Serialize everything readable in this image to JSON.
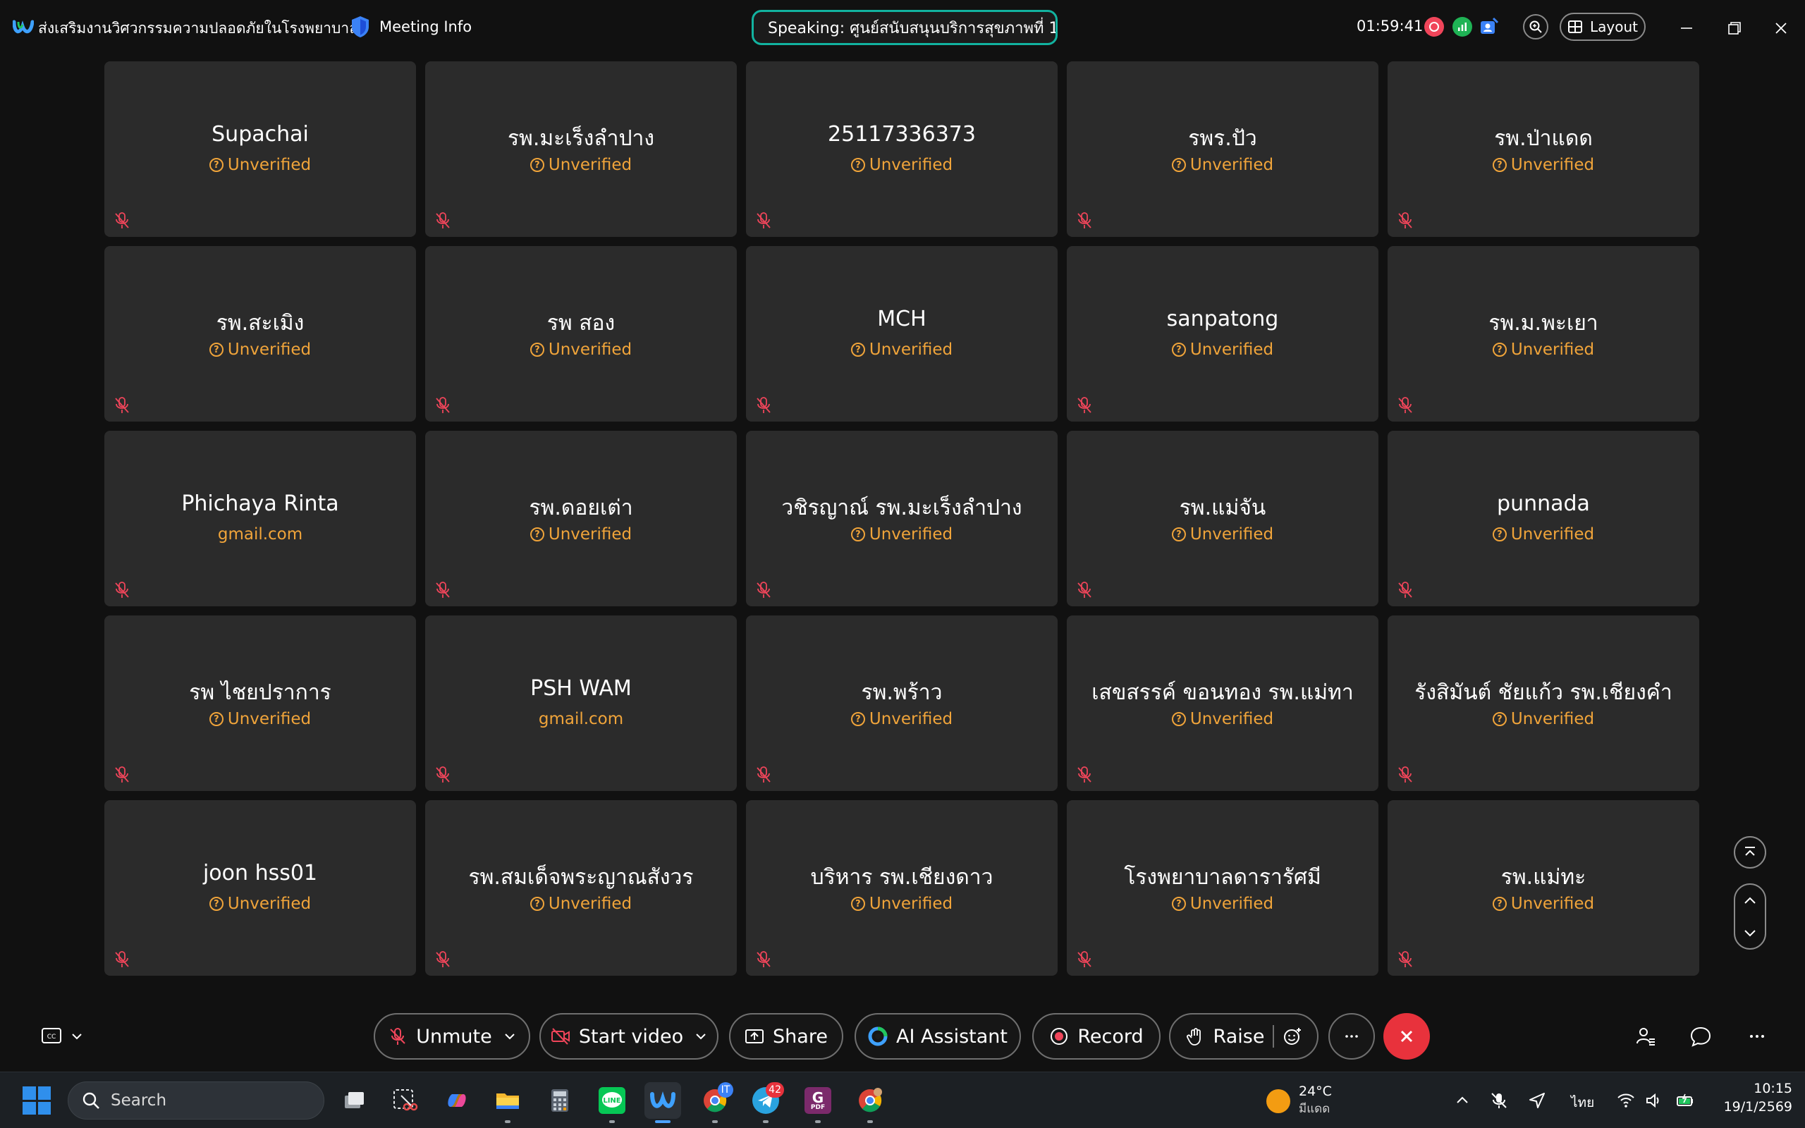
{
  "titlebar": {
    "meeting_title": "ส่งเสริมงานวิศวกรรมความปลอดภัยในโรงพยาบาล",
    "meeting_info_label": "Meeting Info",
    "speaking": "Speaking: ศูนย์สนับสนุนบริการสุขภาพที่ 1",
    "elapsed": "01:59:41",
    "layout_label": "Layout"
  },
  "participants": [
    {
      "name": "Supachai",
      "status": "Unverified",
      "verified_domain": false
    },
    {
      "name": "รพ.มะเร็งลำปาง",
      "status": "Unverified",
      "verified_domain": false
    },
    {
      "name": "25117336373",
      "status": "Unverified",
      "verified_domain": false
    },
    {
      "name": "รพร.ปัว",
      "status": "Unverified",
      "verified_domain": false
    },
    {
      "name": "รพ.ป่าแดด",
      "status": "Unverified",
      "verified_domain": false
    },
    {
      "name": "รพ.สะเมิง",
      "status": "Unverified",
      "verified_domain": false
    },
    {
      "name": "รพ สอง",
      "status": "Unverified",
      "verified_domain": false
    },
    {
      "name": "MCH",
      "status": "Unverified",
      "verified_domain": false
    },
    {
      "name": "sanpatong",
      "status": "Unverified",
      "verified_domain": false
    },
    {
      "name": "รพ.ม.พะเยา",
      "status": "Unverified",
      "verified_domain": false
    },
    {
      "name": "Phichaya Rinta",
      "status": "gmail.com",
      "verified_domain": true
    },
    {
      "name": "รพ.ดอยเต่า",
      "status": "Unverified",
      "verified_domain": false
    },
    {
      "name": "วชิรญาณ์ รพ.มะเร็งลำปาง",
      "status": "Unverified",
      "verified_domain": false
    },
    {
      "name": "รพ.แม่จัน",
      "status": "Unverified",
      "verified_domain": false
    },
    {
      "name": "punnada",
      "status": "Unverified",
      "verified_domain": false
    },
    {
      "name": "รพ ไชยปราการ",
      "status": "Unverified",
      "verified_domain": false
    },
    {
      "name": "PSH WAM",
      "status": "gmail.com",
      "verified_domain": true
    },
    {
      "name": "รพ.พร้าว",
      "status": "Unverified",
      "verified_domain": false
    },
    {
      "name": "เสขสรรค์ ขอนทอง รพ.แม่ทา",
      "status": "Unverified",
      "verified_domain": false
    },
    {
      "name": "รังสิมันต์ ชัยแก้ว รพ.เชียงคำ",
      "status": "Unverified",
      "verified_domain": false
    },
    {
      "name": "joon hss01",
      "status": "Unverified",
      "verified_domain": false
    },
    {
      "name": "รพ.สมเด็จพระญาณสังวร",
      "status": "Unverified",
      "verified_domain": false
    },
    {
      "name": "บริหาร รพ.เชียงดาว",
      "status": "Unverified",
      "verified_domain": false
    },
    {
      "name": "โรงพยาบาลดารารัศมี",
      "status": "Unverified",
      "verified_domain": false
    },
    {
      "name": "รพ.แม่ทะ",
      "status": "Unverified",
      "verified_domain": false
    }
  ],
  "controls": {
    "unmute": "Unmute",
    "start_video": "Start video",
    "share": "Share",
    "ai_assistant": "AI Assistant",
    "record": "Record",
    "raise": "Raise"
  },
  "taskbar": {
    "search_placeholder": "Search",
    "chrome_badge": "IT",
    "telegram_badge": "42",
    "pdf_label": "PDF",
    "weather_temp": "24°C",
    "weather_cond": "มีแดด",
    "lang": "ไทย",
    "time": "10:15",
    "date": "19/1/2569"
  },
  "colors": {
    "accent_teal": "#12b3a0",
    "unverified_orange": "#f0a43a",
    "end_red": "#e8323c",
    "tile_bg": "#2b2b2b"
  },
  "icons": {
    "app_logo": "webex-logo-icon",
    "meeting_info": "shield-icon",
    "end_call": "close-icon"
  }
}
